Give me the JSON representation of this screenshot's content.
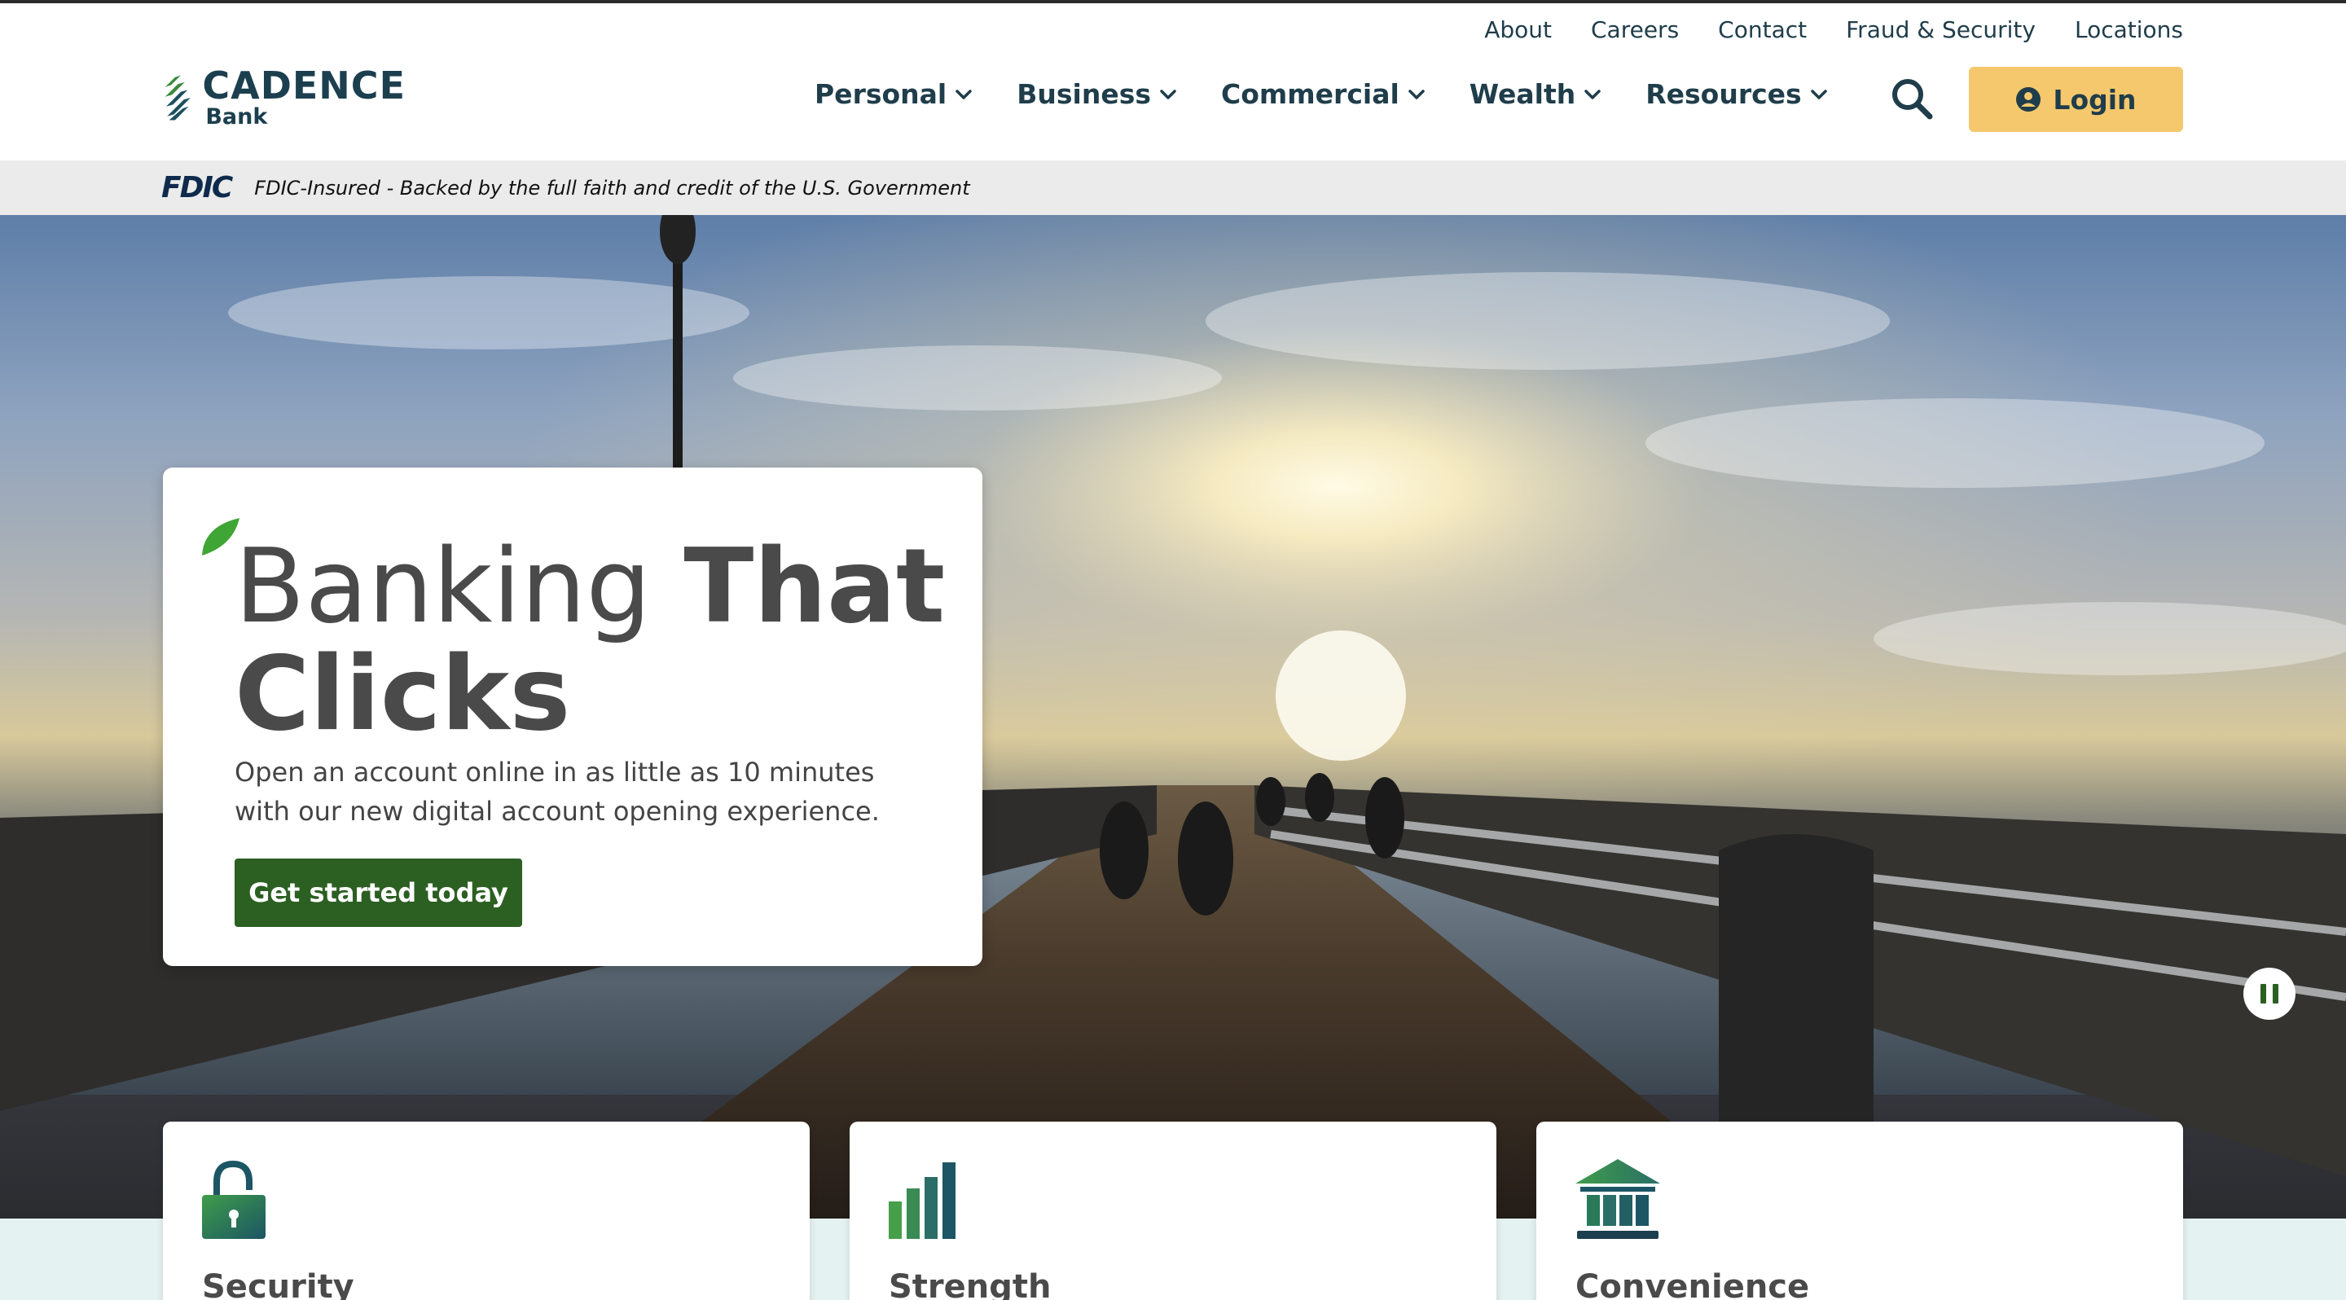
{
  "brand": {
    "name": "CADENCE",
    "sub": "Bank"
  },
  "utility_nav": [
    "About",
    "Careers",
    "Contact",
    "Fraud & Security",
    "Locations"
  ],
  "main_nav": [
    "Personal",
    "Business",
    "Commercial",
    "Wealth",
    "Resources"
  ],
  "login": {
    "label": "Login"
  },
  "fdic": {
    "logo": "FDIC",
    "text": "FDIC-Insured - Backed by the full faith and credit of the U.S. Government"
  },
  "hero": {
    "title_light": "Banking ",
    "title_bold_1": "That",
    "title_bold_2": "Clicks",
    "description": "Open an account online in as little as 10 minutes with our new digital account opening experience.",
    "cta": "Get started today"
  },
  "features": [
    {
      "title": "Security",
      "icon": "lock-icon"
    },
    {
      "title": "Strength",
      "icon": "bar-chart-icon"
    },
    {
      "title": "Convenience",
      "icon": "bank-building-icon"
    }
  ],
  "colors": {
    "brand_dark": "#1f3d4a",
    "brand_green": "#2c5f22",
    "login_yellow": "#f6c86d",
    "fdic_bar": "#ebebeb",
    "feature_bg": "#e5f2f2"
  }
}
